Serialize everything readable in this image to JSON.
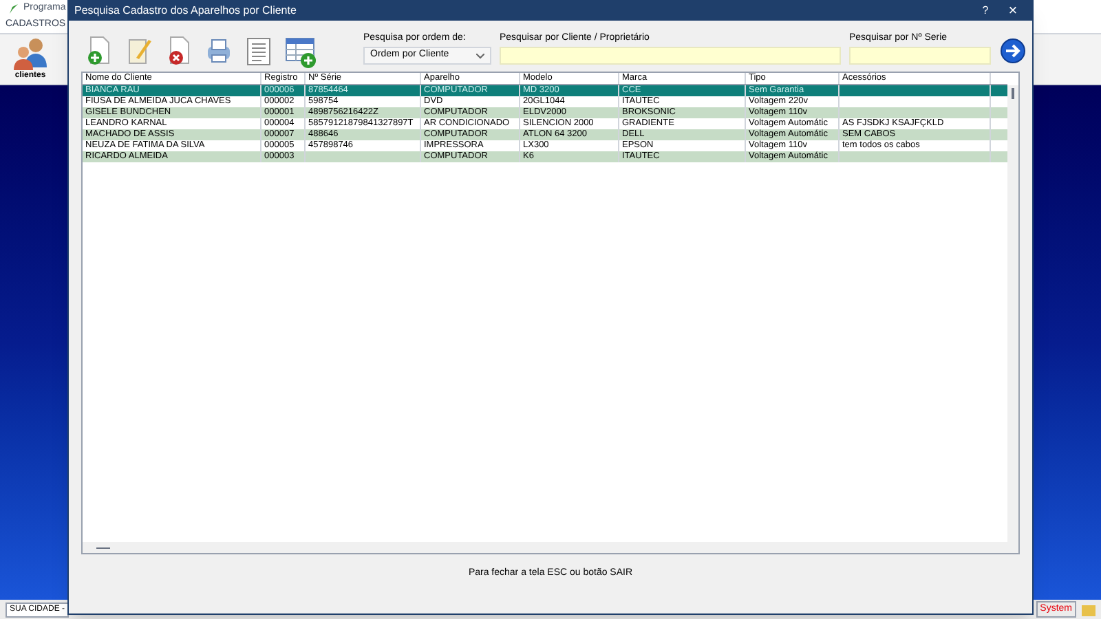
{
  "background_app": {
    "title": "Programa",
    "menu": [
      "CADASTROS"
    ],
    "toolbar": [
      {
        "label": "clientes"
      }
    ],
    "status_bar": {
      "city": "SUA CIDADE -",
      "system": "System"
    }
  },
  "window": {
    "title": "Pesquisa Cadastro dos Aparelhos por Cliente",
    "help": "?",
    "close": "×"
  },
  "search": {
    "order_label": "Pesquisa por ordem de:",
    "order_value": "Ordem por Cliente",
    "client_label": "Pesquisar por Cliente / Proprietário",
    "serial_label": "Pesquisar por Nº Serie"
  },
  "table": {
    "columns": [
      "Nome do Cliente",
      "Registro",
      "Nº Série",
      "Aparelho",
      "Modelo",
      "Marca",
      "Tipo",
      "Acessórios"
    ],
    "rows": [
      {
        "selected": true,
        "cells": [
          "BIANCA RAU",
          "000006",
          "87854464",
          "COMPUTADOR",
          "MD 3200",
          "CCE",
          "Sem Garantia",
          ""
        ]
      },
      {
        "selected": false,
        "cells": [
          "FIUSA DE ALMEIDA JUCA CHAVES",
          "000002",
          "598754",
          "DVD",
          "20GL1044",
          "ITAUTEC",
          "Voltagem 220v",
          ""
        ]
      },
      {
        "selected": false,
        "cells": [
          "GISELE BUNDCHEN",
          "000001",
          "4898756216422Z",
          "COMPUTADOR",
          "ELDV2000",
          "BROKSONIC",
          "Voltagem 110v",
          ""
        ]
      },
      {
        "selected": false,
        "cells": [
          "LEANDRO KARNAL",
          "000004",
          "58579121879841327897T",
          "AR CONDICIONADO",
          "SILENCION 2000",
          "GRADIENTE",
          "Voltagem Automátic",
          "AS FJSDKJ KSAJFÇKLD"
        ]
      },
      {
        "selected": false,
        "cells": [
          "MACHADO DE ASSIS",
          "000007",
          "488646",
          "COMPUTADOR",
          "ATLON 64 3200",
          "DELL",
          "Voltagem Automátic",
          "SEM CABOS"
        ]
      },
      {
        "selected": false,
        "cells": [
          "NEUZA DE FATIMA DA SILVA",
          "000005",
          "457898746",
          "IMPRESSORA",
          "LX300",
          "EPSON",
          "Voltagem 110v",
          "tem todos os cabos"
        ]
      },
      {
        "selected": false,
        "cells": [
          "RICARDO ALMEIDA",
          "000003",
          "",
          "COMPUTADOR",
          "K6",
          "ITAUTEC",
          "Voltagem Automátic",
          ""
        ]
      }
    ]
  },
  "footer": "Para fechar a tela ESC ou botão SAIR"
}
